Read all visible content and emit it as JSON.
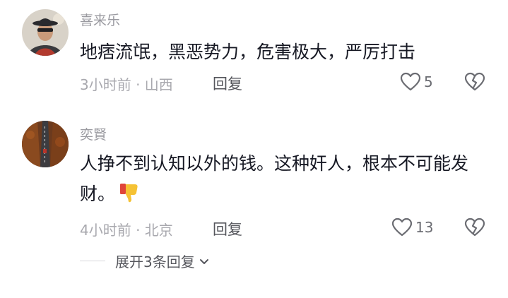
{
  "comments": [
    {
      "username": "喜来乐",
      "text": "地痞流氓，黑恶势力，危害极大，严厉打击",
      "meta": "3小时前 · 山西",
      "reply_label": "回复",
      "like_count": "5"
    },
    {
      "username": "奕賢",
      "text": "人挣不到认知以外的钱。这种奸人，根本不可能发财。",
      "emoji": "thumbs-down-emoji",
      "meta": "4小时前 · 北京",
      "reply_label": "回复",
      "like_count": "13"
    }
  ],
  "expand_replies_label": "展开3条回复",
  "icons": {
    "like": "heart-outline-icon",
    "dislike": "broken-heart-icon",
    "expand": "chevron-down-icon"
  },
  "colors": {
    "text": "#161823",
    "secondary": "#a8a8ae",
    "icon": "#6b6c72",
    "emoji": "#f5c234"
  }
}
